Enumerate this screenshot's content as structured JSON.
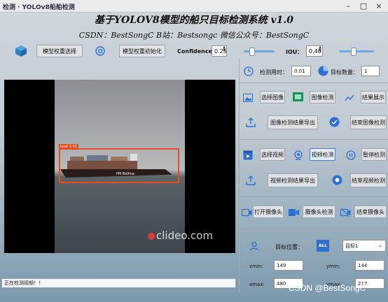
{
  "window": {
    "title": "检测 · YOLOv8船舶检测",
    "controls": [
      "–",
      "□",
      "×"
    ]
  },
  "header": {
    "title": "基于YOLOV8模型的船只目标检测系统 v1.0",
    "subtitle": "CSDN：BestSongC    B站：Bestsongc    微信公众号：BestSongC"
  },
  "toolbar": {
    "model_select_label": "模型权重选择",
    "model_init_label": "模型权重初始化",
    "confidence_label": "Confidence:",
    "confidence_value": "0.25",
    "confidence_level": 0.25,
    "iou_label": "IOU：",
    "iou_value": "0.40",
    "iou_level": 0.4
  },
  "video": {
    "bbox_label": "boat 0.91",
    "watermark": "clideo.com",
    "ship_name": "PM Bellina"
  },
  "panel": {
    "time_label": "检测用时：",
    "time_value": "0.01",
    "count_label": "目标数量：",
    "count_value": "1",
    "image": {
      "select": "选择图像",
      "detect": "图像检测",
      "show": "结果展示",
      "export": "图像检测结果导出",
      "end": "结束图像检测"
    },
    "video": {
      "select": "选择视频",
      "detect": "视频检测",
      "pause": "暂停检测",
      "export": "视频检测结果导出",
      "end": "结束视频检测"
    },
    "camera": {
      "open": "打开摄像头",
      "detect": "摄像头检测",
      "end": "结束摄像头"
    },
    "target_label": "目标位置：",
    "target_select": "目标1",
    "target_badge": "ALL",
    "xmin_label": "xmin:",
    "xmin": "149",
    "ymin_label": "ymin:",
    "ymin": "144",
    "xmax_label": "xmax:",
    "xmax": "480",
    "ymax_label": "ymax:",
    "ymax": "217"
  },
  "status": {
    "text": "正在检测视频！！"
  },
  "footer": {
    "credit": "CSDN @BestSongC"
  },
  "colors": {
    "accent": "#2a6fd6",
    "bbox": "#e84c1e",
    "slider": "#6fa8dc"
  }
}
